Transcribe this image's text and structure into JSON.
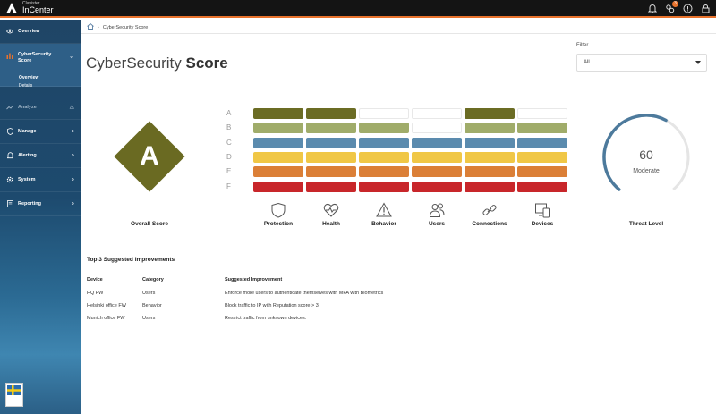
{
  "app": {
    "brand_small": "Clavister",
    "brand_big": "InCenter",
    "notification_count": "3"
  },
  "sidebar": {
    "overview": "Overview",
    "cybersecurity": "CyberSecurity Score",
    "sub_overview": "Overview",
    "sub_details": "Details",
    "analyze": "Analyze",
    "manage": "Manage",
    "alerting": "Alerting",
    "system": "System",
    "reporting": "Reporting"
  },
  "breadcrumb": {
    "current": "CyberSecurity Score"
  },
  "page": {
    "title_light": "CyberSecurity",
    "title_bold": "Score"
  },
  "filter": {
    "label": "Filter",
    "value": "All"
  },
  "overall": {
    "grade": "A",
    "label": "Overall Score"
  },
  "grid": {
    "rows": [
      "A",
      "B",
      "C",
      "D",
      "E",
      "F"
    ],
    "row_colors": [
      "#6b6c24",
      "#a0ac6a",
      "#5b8bae",
      "#f0c746",
      "#db7f37",
      "#c8262a"
    ],
    "categories": [
      {
        "label": "Protection",
        "icon": "shield-icon",
        "grade": "A"
      },
      {
        "label": "Health",
        "icon": "heart-pulse-icon",
        "grade": "A"
      },
      {
        "label": "Behavior",
        "icon": "warning-triangle-icon",
        "grade": "B"
      },
      {
        "label": "Users",
        "icon": "users-icon",
        "grade": "C"
      },
      {
        "label": "Connections",
        "icon": "link-icon",
        "grade": "A"
      },
      {
        "label": "Devices",
        "icon": "devices-icon",
        "grade": "B"
      }
    ]
  },
  "threat": {
    "value": "60",
    "text": "Moderate",
    "label": "Threat Level",
    "fraction": 0.6,
    "color": "#4d7a9c",
    "track": "#e5e5e5"
  },
  "improvements": {
    "title": "Top 3 Suggested Improvements",
    "headers": {
      "device": "Device",
      "category": "Category",
      "improvement": "Suggested Improvement"
    },
    "rows": [
      {
        "device": "HQ FW",
        "category": "Users",
        "improvement": "Enforce more users to authenticate themselves with MFA with Biometrics"
      },
      {
        "device": "Helsinki office FW",
        "category": "Behavior",
        "improvement": "Block traffic to IP with Reputation score > 3"
      },
      {
        "device": "Munich office FW",
        "category": "Users",
        "improvement": "Restrict traffic from unknown devices."
      }
    ]
  }
}
